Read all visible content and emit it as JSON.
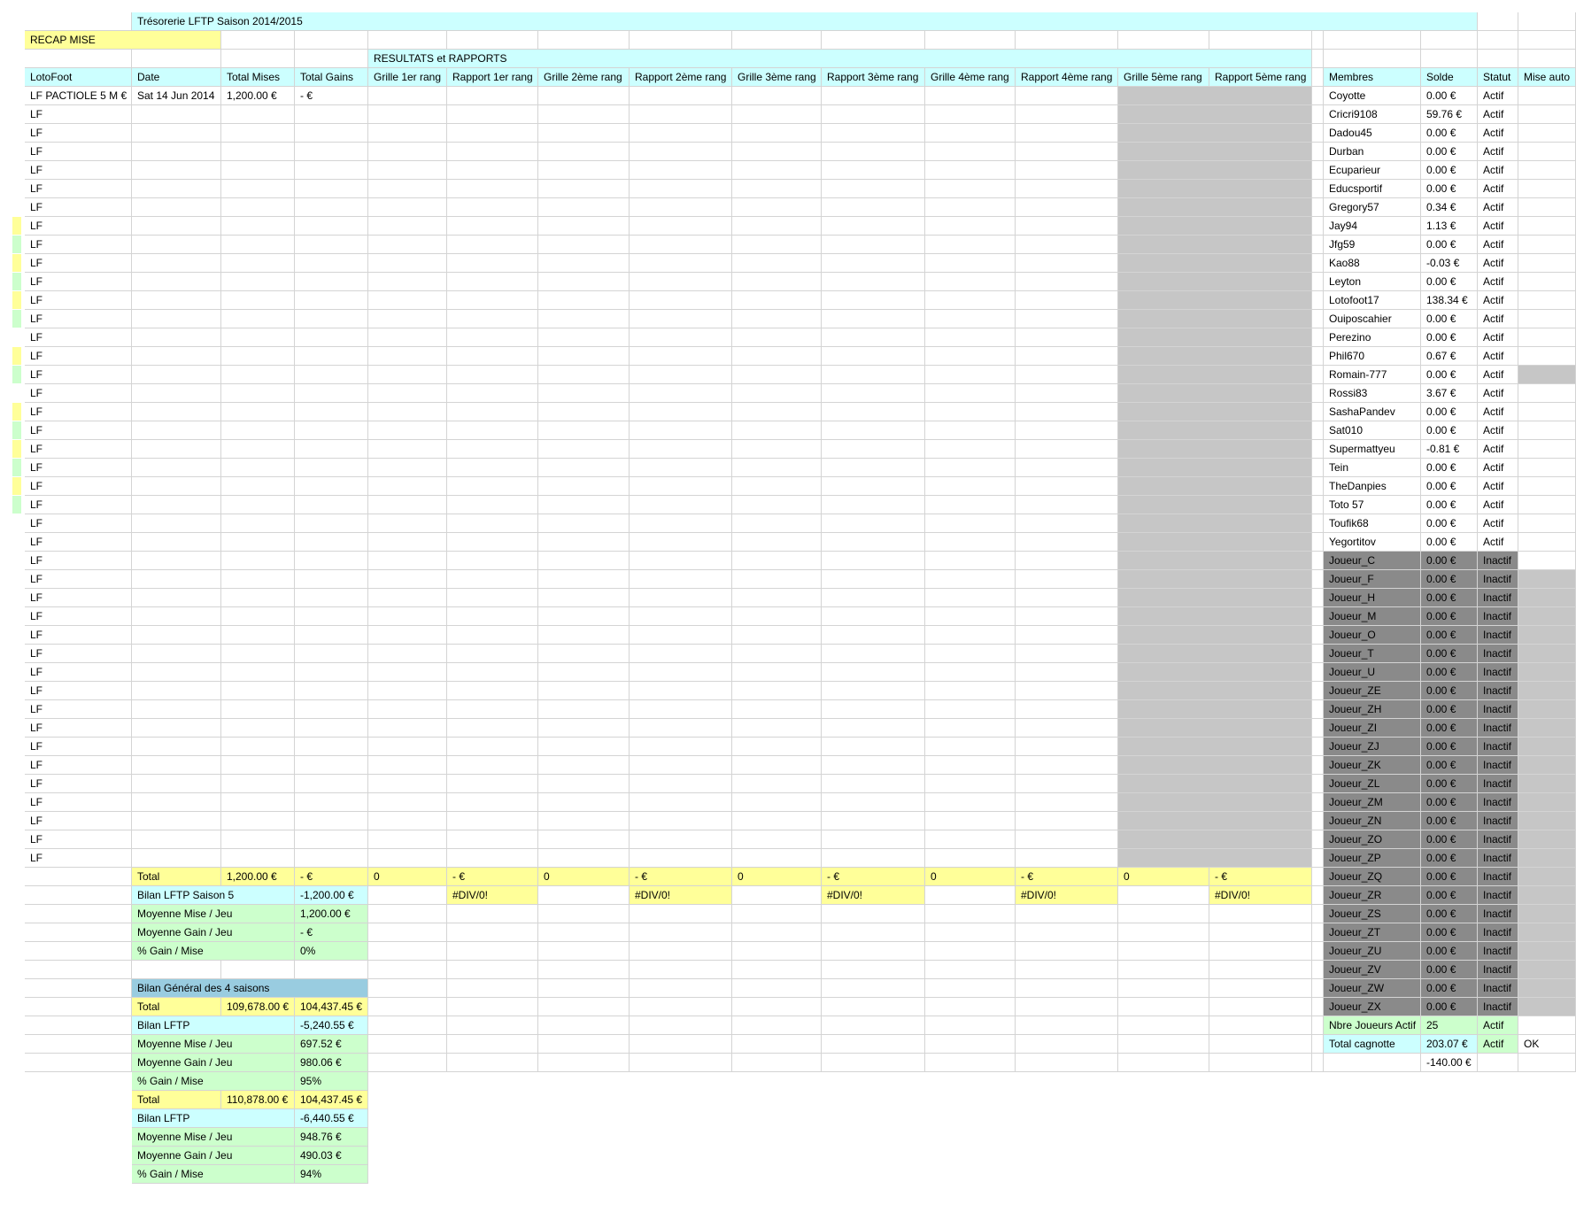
{
  "title": "Trésorerie LFTP Saison 2014/2015",
  "recap_label": "RECAP MISE",
  "resultats_label": "RESULTATS et RAPPORTS",
  "headers": [
    "LotoFoot",
    "Date",
    "Total Mises",
    "Total Gains",
    "Grille 1er rang",
    "Rapport 1er rang",
    "Grille 2ème rang",
    "Rapport 2ème rang",
    "Grille 3ème rang",
    "Rapport 3ème rang",
    "Grille 4ème rang",
    "Rapport 4ème rang",
    "Grille 5ème rang",
    "Rapport 5ème rang",
    "Membres",
    "Solde",
    "Statut",
    "Mise auto"
  ],
  "first_row": {
    "lotofoot": "LF PACTIOLE 5 M €",
    "date": "Sat 14 Jun 2014",
    "total_mises": "1,200.00 €",
    "total_gains": "- €"
  },
  "lf_label": "LF",
  "lf_count": 42,
  "row_indicators": [
    "",
    "",
    "",
    "",
    "",
    "",
    "",
    "yellow",
    "green",
    "yellow",
    "green",
    "yellow",
    "green",
    "",
    "yellow",
    "green",
    "",
    "yellow",
    "green",
    "yellow",
    "green",
    "yellow",
    "green"
  ],
  "members": [
    {
      "name": "Coyotte",
      "solde": "0.00 €",
      "statut": "Actif"
    },
    {
      "name": "Cricri9108",
      "solde": "59.76 €",
      "statut": "Actif"
    },
    {
      "name": "Dadou45",
      "solde": "0.00 €",
      "statut": "Actif"
    },
    {
      "name": "Durban",
      "solde": "0.00 €",
      "statut": "Actif"
    },
    {
      "name": "Ecuparieur",
      "solde": "0.00 €",
      "statut": "Actif"
    },
    {
      "name": "Educsportif",
      "solde": "0.00 €",
      "statut": "Actif"
    },
    {
      "name": "Gregory57",
      "solde": "0.34 €",
      "statut": "Actif"
    },
    {
      "name": "Jay94",
      "solde": "1.13 €",
      "statut": "Actif"
    },
    {
      "name": "Jfg59",
      "solde": "0.00 €",
      "statut": "Actif"
    },
    {
      "name": "Kao88",
      "solde": "-0.03 €",
      "statut": "Actif"
    },
    {
      "name": "Leyton",
      "solde": "0.00 €",
      "statut": "Actif"
    },
    {
      "name": "Lotofoot17",
      "solde": "138.34 €",
      "statut": "Actif"
    },
    {
      "name": "Ouiposcahier",
      "solde": "0.00 €",
      "statut": "Actif"
    },
    {
      "name": "Perezino",
      "solde": "0.00 €",
      "statut": "Actif"
    },
    {
      "name": "Phil670",
      "solde": "0.67 €",
      "statut": "Actif"
    },
    {
      "name": "Romain-777",
      "solde": "0.00 €",
      "statut": "Actif",
      "mise_auto_gray": true
    },
    {
      "name": "Rossi83",
      "solde": "3.67 €",
      "statut": "Actif"
    },
    {
      "name": "SashaPandev",
      "solde": "0.00 €",
      "statut": "Actif"
    },
    {
      "name": "Sat010",
      "solde": "0.00 €",
      "statut": "Actif"
    },
    {
      "name": "Supermattyeu",
      "solde": "-0.81 €",
      "statut": "Actif"
    },
    {
      "name": "Tein",
      "solde": "0.00 €",
      "statut": "Actif"
    },
    {
      "name": "TheDanpies",
      "solde": "0.00 €",
      "statut": "Actif"
    },
    {
      "name": "Toto 57",
      "solde": "0.00 €",
      "statut": "Actif"
    },
    {
      "name": "Toufik68",
      "solde": "0.00 €",
      "statut": "Actif"
    },
    {
      "name": "Yegortitov",
      "solde": "0.00 €",
      "statut": "Actif"
    },
    {
      "name": "Joueur_C",
      "solde": "0.00 €",
      "statut": "Inactif"
    },
    {
      "name": "Joueur_F",
      "solde": "0.00 €",
      "statut": "Inactif"
    },
    {
      "name": "Joueur_H",
      "solde": "0.00 €",
      "statut": "Inactif"
    },
    {
      "name": "Joueur_M",
      "solde": "0.00 €",
      "statut": "Inactif"
    },
    {
      "name": "Joueur_O",
      "solde": "0.00 €",
      "statut": "Inactif"
    },
    {
      "name": "Joueur_T",
      "solde": "0.00 €",
      "statut": "Inactif"
    },
    {
      "name": "Joueur_U",
      "solde": "0.00 €",
      "statut": "Inactif"
    },
    {
      "name": "Joueur_ZE",
      "solde": "0.00 €",
      "statut": "Inactif"
    },
    {
      "name": "Joueur_ZH",
      "solde": "0.00 €",
      "statut": "Inactif"
    },
    {
      "name": "Joueur_ZI",
      "solde": "0.00 €",
      "statut": "Inactif"
    },
    {
      "name": "Joueur_ZJ",
      "solde": "0.00 €",
      "statut": "Inactif"
    },
    {
      "name": "Joueur_ZK",
      "solde": "0.00 €",
      "statut": "Inactif"
    },
    {
      "name": "Joueur_ZL",
      "solde": "0.00 €",
      "statut": "Inactif"
    },
    {
      "name": "Joueur_ZM",
      "solde": "0.00 €",
      "statut": "Inactif"
    },
    {
      "name": "Joueur_ZN",
      "solde": "0.00 €",
      "statut": "Inactif"
    },
    {
      "name": "Joueur_ZO",
      "solde": "0.00 €",
      "statut": "Inactif"
    },
    {
      "name": "Joueur_ZP",
      "solde": "0.00 €",
      "statut": "Inactif"
    },
    {
      "name": "Joueur_ZQ",
      "solde": "0.00 €",
      "statut": "Inactif"
    },
    {
      "name": "Joueur_ZR",
      "solde": "0.00 €",
      "statut": "Inactif"
    },
    {
      "name": "Joueur_ZS",
      "solde": "0.00 €",
      "statut": "Inactif"
    },
    {
      "name": "Joueur_ZT",
      "solde": "0.00 €",
      "statut": "Inactif"
    },
    {
      "name": "Joueur_ZU",
      "solde": "0.00 €",
      "statut": "Inactif"
    },
    {
      "name": "Joueur_ZV",
      "solde": "0.00 €",
      "statut": "Inactif"
    },
    {
      "name": "Joueur_ZW",
      "solde": "0.00 €",
      "statut": "Inactif"
    },
    {
      "name": "Joueur_ZX",
      "solde": "0.00 €",
      "statut": "Inactif"
    }
  ],
  "totals_row": [
    "Total",
    "1,200.00 €",
    "- €",
    "0",
    "- €",
    "0",
    "- €",
    "0",
    "- €",
    "0",
    "- €",
    "0",
    "- €"
  ],
  "bilan_saison": {
    "label": "Bilan LFTP Saison 5",
    "value": "-1,200.00 €",
    "div": "#DIV/0!"
  },
  "saison_stats": [
    {
      "label": "Moyenne Mise / Jeu",
      "value": "1,200.00 €"
    },
    {
      "label": "Moyenne Gain / Jeu",
      "value": "- €"
    },
    {
      "label": "% Gain / Mise",
      "value": "0%"
    }
  ],
  "bilan_general_label": "Bilan Général des 4 saisons",
  "general": {
    "total": {
      "label": "Total",
      "mises": "109,678.00 €",
      "gains": "104,437.45 €"
    },
    "rows": [
      {
        "label": "Bilan LFTP",
        "value": "-5,240.55 €"
      },
      {
        "label": "Moyenne Mise / Jeu",
        "value": "697.52 €"
      },
      {
        "label": "Moyenne Gain / Jeu",
        "value": "980.06 €"
      },
      {
        "label": "% Gain / Mise",
        "value": "95%"
      }
    ]
  },
  "general2": {
    "total": {
      "label": "Total",
      "mises": "110,878.00 €",
      "gains": "104,437.45 €"
    },
    "rows": [
      {
        "label": "Bilan LFTP",
        "value": "-6,440.55 €"
      },
      {
        "label": "Moyenne Mise / Jeu",
        "value": "948.76 €"
      },
      {
        "label": "Moyenne Gain / Jeu",
        "value": "490.03 €"
      },
      {
        "label": "% Gain / Mise",
        "value": "94%"
      }
    ]
  },
  "summary": {
    "nbre_label": "Nbre Joueurs Actif",
    "nbre_value": "25",
    "nbre_statut": "Actif",
    "cagnotte_label": "Total cagnotte",
    "cagnotte_value": "203.07 €",
    "cagnotte_statut": "Actif",
    "cagnotte_ok": "OK",
    "extra_value": "-140.00 €"
  }
}
